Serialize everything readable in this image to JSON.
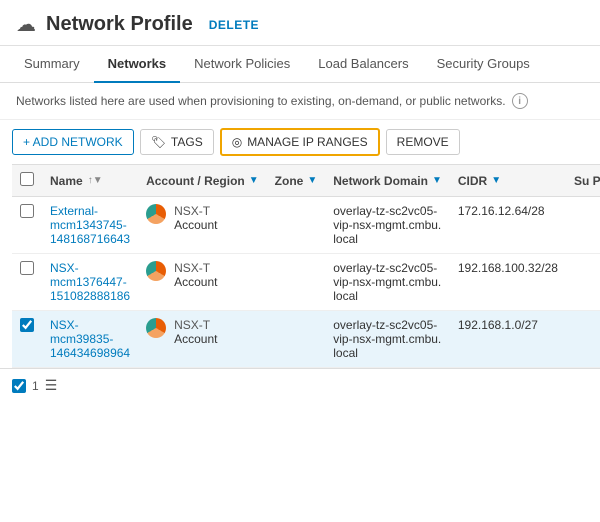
{
  "header": {
    "icon": "☁",
    "title": "Network Profile",
    "delete_label": "DELETE"
  },
  "tabs": [
    {
      "id": "summary",
      "label": "Summary",
      "active": false
    },
    {
      "id": "networks",
      "label": "Networks",
      "active": true
    },
    {
      "id": "network-policies",
      "label": "Network Policies",
      "active": false
    },
    {
      "id": "load-balancers",
      "label": "Load Balancers",
      "active": false
    },
    {
      "id": "security-groups",
      "label": "Security Groups",
      "active": false
    }
  ],
  "info_text": "Networks listed here are used when provisioning to existing, on-demand, or public networks.",
  "toolbar": {
    "add_network": "+ ADD NETWORK",
    "tags": "TAGS",
    "manage_ip_ranges": "MANAGE IP RANGES",
    "remove": "REMOVE"
  },
  "table": {
    "columns": [
      {
        "id": "checkbox",
        "label": ""
      },
      {
        "id": "name",
        "label": "Name",
        "sortable": true,
        "filterable": false
      },
      {
        "id": "account_region",
        "label": "Account / Region",
        "sortable": false,
        "filterable": true
      },
      {
        "id": "zone",
        "label": "Zone",
        "sortable": false,
        "filterable": true
      },
      {
        "id": "network_domain",
        "label": "Network Domain",
        "sortable": false,
        "filterable": true
      },
      {
        "id": "cidr",
        "label": "CIDR",
        "sortable": false,
        "filterable": true
      },
      {
        "id": "subnet",
        "label": "Su Pu",
        "sortable": false,
        "filterable": false
      }
    ],
    "rows": [
      {
        "id": "row1",
        "selected": false,
        "name": "External-mcm1343745-148168716643",
        "account_type": "NSX-T",
        "account_name": "Account",
        "zone": "",
        "network_domain": "overlay-tz-sc2vc05-vip-nsx-mgmt.cmbu.local",
        "cidr": "172.16.12.64/28",
        "subnet": ""
      },
      {
        "id": "row2",
        "selected": false,
        "name": "NSX-mcm1376447-151082888186",
        "account_type": "NSX-T",
        "account_name": "Account",
        "zone": "",
        "network_domain": "overlay-tz-sc2vc05-vip-nsx-mgmt.cmbu.local",
        "cidr": "192.168.100.32/28",
        "subnet": ""
      },
      {
        "id": "row3",
        "selected": true,
        "name": "NSX-mcm39835-146434698964",
        "account_type": "NSX-T",
        "account_name": "Account",
        "zone": "",
        "network_domain": "overlay-tz-sc2vc05-vip-nsx-mgmt.cmbu.local",
        "cidr": "192.168.1.0/27",
        "subnet": ""
      }
    ]
  },
  "footer": {
    "count": "1",
    "icon": "☰"
  },
  "colors": {
    "accent": "#007bbd",
    "highlight_border": "#f0a500",
    "selected_row_bg": "#e8f4fb"
  }
}
